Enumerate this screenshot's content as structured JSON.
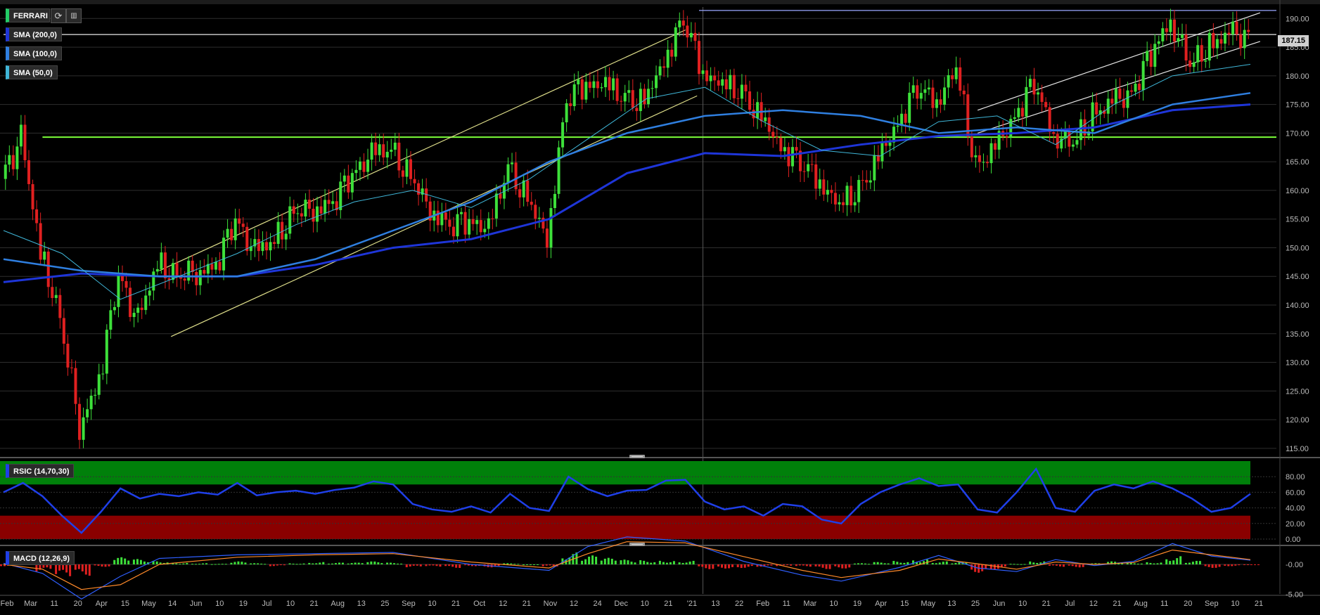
{
  "header": {
    "symbol": "FERRARI",
    "refresh_icon": "refresh-icon",
    "settings_icon": "chart-settings-icon",
    "last_price": "187.15"
  },
  "indicators": {
    "sma200": {
      "label": "SMA (200,0)",
      "color": "#1e35d8"
    },
    "sma100": {
      "label": "SMA (100,0)",
      "color": "#2f7fe0"
    },
    "sma50": {
      "label": "SMA (50,0)",
      "color": "#3fb6d8"
    },
    "rsi": {
      "label": "RSIC (14,70,30)",
      "color": "#1f3fe8"
    },
    "macd": {
      "label": "MACD (12,26,9)"
    }
  },
  "colors": {
    "up": "#3de03a",
    "down": "#e02020",
    "bg": "#000000",
    "grid": "#2e2e2e",
    "support": "#7cff3a",
    "channel_yellow": "#dede8a",
    "channel_white": "#e8e8e8",
    "rsi_overbought": "#00800a",
    "rsi_oversold": "#8a0000",
    "macd_line": "#2f5fff",
    "signal_line": "#ff8a2a"
  },
  "chart_data": {
    "type": "candlestick",
    "x_axis_labels": [
      "Feb",
      "Mar",
      "11",
      "20",
      "Apr",
      "15",
      "May",
      "14",
      "Jun",
      "10",
      "19",
      "Jul",
      "10",
      "21",
      "Aug",
      "13",
      "25",
      "Sep",
      "10",
      "21",
      "Oct",
      "12",
      "21",
      "Nov",
      "12",
      "24",
      "Dec",
      "10",
      "21",
      "'21",
      "13",
      "22",
      "Feb",
      "11",
      "Mar",
      "10",
      "19",
      "Apr",
      "15",
      "May",
      "13",
      "25",
      "Jun",
      "10",
      "21",
      "Jul",
      "12",
      "21",
      "Aug",
      "11",
      "20",
      "Sep",
      "10",
      "21"
    ],
    "price_axis": {
      "ticks": [
        115,
        120,
        125,
        130,
        135,
        140,
        145,
        150,
        155,
        160,
        165,
        170,
        175,
        180,
        185,
        190
      ],
      "ylim": [
        114,
        192
      ]
    },
    "last_price": 187.15,
    "horizontal_levels": [
      {
        "value": 169.3,
        "color": "#7cff3a",
        "from_week": 2
      },
      {
        "value": 187.2,
        "color": "#e8e8e8",
        "from_week": 0
      },
      {
        "value": 191.4,
        "color": "#9aa8ff",
        "from_week": 35.7
      },
      {
        "value": 193.3,
        "color": "#9aa8ff",
        "from_week": 61.8
      }
    ],
    "weekly_closes": [
      [
        0,
        162
      ],
      [
        1,
        169
      ],
      [
        2,
        149
      ],
      [
        3,
        138
      ],
      [
        4,
        119
      ],
      [
        5,
        127
      ],
      [
        6,
        145
      ],
      [
        7,
        137
      ],
      [
        8,
        147
      ],
      [
        9,
        145
      ],
      [
        10,
        146
      ],
      [
        11,
        147
      ],
      [
        12,
        155
      ],
      [
        13,
        149
      ],
      [
        14,
        151
      ],
      [
        15,
        156
      ],
      [
        16,
        157
      ],
      [
        17,
        158
      ],
      [
        18,
        163
      ],
      [
        19,
        166
      ],
      [
        20,
        167
      ],
      [
        21,
        162
      ],
      [
        22,
        157
      ],
      [
        23,
        154
      ],
      [
        24,
        155
      ],
      [
        25,
        153
      ],
      [
        26,
        164
      ],
      [
        27,
        158
      ],
      [
        28,
        152
      ],
      [
        29,
        176
      ],
      [
        30,
        179
      ],
      [
        31,
        178
      ],
      [
        32,
        176
      ],
      [
        33,
        175
      ],
      [
        34,
        183
      ],
      [
        35,
        190
      ],
      [
        36,
        181
      ],
      [
        37,
        178
      ],
      [
        38,
        177
      ],
      [
        39,
        172
      ],
      [
        40,
        168
      ],
      [
        41,
        165
      ],
      [
        42,
        162
      ],
      [
        43,
        157
      ],
      [
        44,
        160
      ],
      [
        45,
        165
      ],
      [
        46,
        172
      ],
      [
        47,
        178
      ],
      [
        48,
        176
      ],
      [
        49,
        181
      ],
      [
        50,
        164
      ],
      [
        51,
        167
      ],
      [
        52,
        173
      ],
      [
        53,
        179
      ],
      [
        54,
        170
      ],
      [
        55,
        168
      ],
      [
        56,
        173
      ],
      [
        57,
        175
      ],
      [
        58,
        177
      ],
      [
        59,
        184
      ],
      [
        60,
        190
      ],
      [
        61,
        182
      ],
      [
        62,
        185
      ],
      [
        63,
        187
      ],
      [
        64,
        187
      ]
    ],
    "sma50": [
      [
        0,
        153
      ],
      [
        3,
        149
      ],
      [
        6,
        141
      ],
      [
        9,
        145
      ],
      [
        12,
        149
      ],
      [
        15,
        154
      ],
      [
        18,
        158
      ],
      [
        21,
        160
      ],
      [
        24,
        157
      ],
      [
        27,
        162
      ],
      [
        30,
        169
      ],
      [
        33,
        176
      ],
      [
        36,
        178
      ],
      [
        39,
        172
      ],
      [
        42,
        167
      ],
      [
        45,
        166
      ],
      [
        48,
        172
      ],
      [
        51,
        173
      ],
      [
        54,
        168
      ],
      [
        57,
        175
      ],
      [
        60,
        180
      ],
      [
        64,
        182
      ]
    ],
    "sma100": [
      [
        0,
        148
      ],
      [
        4,
        146
      ],
      [
        8,
        145
      ],
      [
        12,
        145
      ],
      [
        16,
        148
      ],
      [
        20,
        153
      ],
      [
        24,
        158
      ],
      [
        28,
        165
      ],
      [
        32,
        170
      ],
      [
        36,
        173
      ],
      [
        40,
        174
      ],
      [
        44,
        173
      ],
      [
        48,
        170
      ],
      [
        52,
        171
      ],
      [
        56,
        170
      ],
      [
        60,
        175
      ],
      [
        64,
        177
      ]
    ],
    "sma200": [
      [
        0,
        144
      ],
      [
        4,
        145.5
      ],
      [
        8,
        145
      ],
      [
        12,
        145
      ],
      [
        16,
        147
      ],
      [
        20,
        150
      ],
      [
        24,
        151.5
      ],
      [
        28,
        155
      ],
      [
        32,
        163
      ],
      [
        36,
        166.5
      ],
      [
        40,
        166
      ],
      [
        44,
        168
      ],
      [
        48,
        169.5
      ],
      [
        52,
        170
      ],
      [
        56,
        171
      ],
      [
        60,
        174
      ],
      [
        64,
        175
      ]
    ],
    "trendlines": [
      {
        "color": "#dede8a",
        "from": [
          8,
          146
        ],
        "to": [
          35,
          188
        ]
      },
      {
        "color": "#dede8a",
        "from": [
          8.6,
          134.5
        ],
        "to": [
          35.6,
          176.5
        ]
      },
      {
        "color": "#e8e8e8",
        "from": [
          50,
          174
        ],
        "to": [
          64.5,
          191
        ]
      },
      {
        "color": "#e8e8e8",
        "from": [
          50,
          170
        ],
        "to": [
          64.5,
          186
        ]
      }
    ],
    "rsi": {
      "ticks": [
        0,
        20,
        40,
        60,
        80
      ],
      "overbought": 70,
      "oversold": 30,
      "values": [
        [
          0,
          60
        ],
        [
          1,
          72
        ],
        [
          2,
          55
        ],
        [
          3,
          30
        ],
        [
          4,
          8
        ],
        [
          5,
          35
        ],
        [
          6,
          65
        ],
        [
          7,
          52
        ],
        [
          8,
          58
        ],
        [
          9,
          55
        ],
        [
          10,
          60
        ],
        [
          11,
          57
        ],
        [
          12,
          72
        ],
        [
          13,
          56
        ],
        [
          14,
          60
        ],
        [
          15,
          62
        ],
        [
          16,
          58
        ],
        [
          17,
          63
        ],
        [
          18,
          66
        ],
        [
          19,
          74
        ],
        [
          20,
          70
        ],
        [
          21,
          45
        ],
        [
          22,
          38
        ],
        [
          23,
          35
        ],
        [
          24,
          42
        ],
        [
          25,
          34
        ],
        [
          26,
          58
        ],
        [
          27,
          40
        ],
        [
          28,
          36
        ],
        [
          29,
          80
        ],
        [
          30,
          64
        ],
        [
          31,
          55
        ],
        [
          32,
          62
        ],
        [
          33,
          63
        ],
        [
          34,
          75
        ],
        [
          35,
          76
        ],
        [
          36,
          48
        ],
        [
          37,
          38
        ],
        [
          38,
          42
        ],
        [
          39,
          30
        ],
        [
          40,
          45
        ],
        [
          41,
          42
        ],
        [
          42,
          25
        ],
        [
          43,
          20
        ],
        [
          44,
          45
        ],
        [
          45,
          60
        ],
        [
          46,
          70
        ],
        [
          47,
          78
        ],
        [
          48,
          68
        ],
        [
          49,
          70
        ],
        [
          50,
          38
        ],
        [
          51,
          34
        ],
        [
          52,
          60
        ],
        [
          53,
          90
        ],
        [
          54,
          40
        ],
        [
          55,
          35
        ],
        [
          56,
          62
        ],
        [
          57,
          70
        ],
        [
          58,
          65
        ],
        [
          59,
          74
        ],
        [
          60,
          65
        ],
        [
          61,
          52
        ],
        [
          62,
          35
        ],
        [
          63,
          40
        ],
        [
          64,
          58
        ]
      ]
    },
    "macd": {
      "ticks": [
        0,
        -5
      ],
      "histogram": [
        [
          0,
          -0.3
        ],
        [
          1,
          0.4
        ],
        [
          2,
          -1.2
        ],
        [
          3,
          -2.2
        ],
        [
          4,
          -1.9
        ],
        [
          5,
          -0.4
        ],
        [
          6,
          1.2
        ],
        [
          7,
          0.9
        ],
        [
          8,
          0.6
        ],
        [
          9,
          0.3
        ],
        [
          10,
          0.2
        ],
        [
          11,
          0.1
        ],
        [
          12,
          0.5
        ],
        [
          13,
          0.2
        ],
        [
          14,
          -0.3
        ],
        [
          15,
          0.2
        ],
        [
          16,
          0.4
        ],
        [
          17,
          0.3
        ],
        [
          18,
          0.3
        ],
        [
          19,
          0.5
        ],
        [
          20,
          0.3
        ],
        [
          21,
          -0.5
        ],
        [
          22,
          -0.4
        ],
        [
          23,
          -0.6
        ],
        [
          24,
          -0.3
        ],
        [
          25,
          -0.5
        ],
        [
          26,
          0.2
        ],
        [
          27,
          0.0
        ],
        [
          28,
          -0.4
        ],
        [
          29,
          2.0
        ],
        [
          30,
          1.5
        ],
        [
          31,
          1.1
        ],
        [
          32,
          0.8
        ],
        [
          33,
          0.7
        ],
        [
          34,
          0.7
        ],
        [
          35,
          0.6
        ],
        [
          36,
          -0.8
        ],
        [
          37,
          -0.7
        ],
        [
          38,
          -0.6
        ],
        [
          39,
          -0.4
        ],
        [
          40,
          -0.3
        ],
        [
          41,
          -0.4
        ],
        [
          42,
          -0.8
        ],
        [
          43,
          -0.7
        ],
        [
          44,
          0.2
        ],
        [
          45,
          0.4
        ],
        [
          46,
          0.6
        ],
        [
          47,
          0.9
        ],
        [
          48,
          0.5
        ],
        [
          49,
          0.4
        ],
        [
          50,
          -1.4
        ],
        [
          51,
          -0.9
        ],
        [
          52,
          0.1
        ],
        [
          53,
          0.6
        ],
        [
          54,
          -0.4
        ],
        [
          55,
          -0.5
        ],
        [
          56,
          0.2
        ],
        [
          57,
          0.5
        ],
        [
          58,
          0.3
        ],
        [
          59,
          0.4
        ],
        [
          60,
          1.4
        ],
        [
          61,
          0.6
        ],
        [
          62,
          -0.6
        ],
        [
          63,
          -0.3
        ],
        [
          64,
          -0.1
        ]
      ],
      "macd_line": [
        [
          0,
          0.2
        ],
        [
          2,
          -1.5
        ],
        [
          4,
          -5.8
        ],
        [
          6,
          -2.0
        ],
        [
          8,
          1.0
        ],
        [
          12,
          1.6
        ],
        [
          16,
          1.8
        ],
        [
          20,
          2.0
        ],
        [
          24,
          0.0
        ],
        [
          28,
          -1.0
        ],
        [
          30,
          3.0
        ],
        [
          32,
          4.6
        ],
        [
          35,
          3.9
        ],
        [
          38,
          0.5
        ],
        [
          41,
          -1.8
        ],
        [
          43,
          -2.8
        ],
        [
          46,
          -0.5
        ],
        [
          48,
          1.5
        ],
        [
          50,
          -0.6
        ],
        [
          52,
          -1.2
        ],
        [
          54,
          0.8
        ],
        [
          56,
          -0.2
        ],
        [
          58,
          0.5
        ],
        [
          60,
          3.5
        ],
        [
          62,
          1.4
        ],
        [
          64,
          0.7
        ]
      ],
      "signal_line": [
        [
          0,
          0.0
        ],
        [
          2,
          -0.8
        ],
        [
          4,
          -4.2
        ],
        [
          6,
          -3.4
        ],
        [
          8,
          0.0
        ],
        [
          12,
          1.2
        ],
        [
          16,
          1.6
        ],
        [
          20,
          1.8
        ],
        [
          24,
          0.4
        ],
        [
          28,
          -0.6
        ],
        [
          30,
          1.8
        ],
        [
          32,
          3.8
        ],
        [
          35,
          3.6
        ],
        [
          38,
          1.3
        ],
        [
          41,
          -1.0
        ],
        [
          43,
          -2.2
        ],
        [
          46,
          -1.0
        ],
        [
          48,
          0.9
        ],
        [
          50,
          0.1
        ],
        [
          52,
          -0.8
        ],
        [
          54,
          0.4
        ],
        [
          56,
          0.0
        ],
        [
          58,
          0.3
        ],
        [
          60,
          2.4
        ],
        [
          62,
          1.6
        ],
        [
          64,
          0.8
        ]
      ]
    }
  }
}
